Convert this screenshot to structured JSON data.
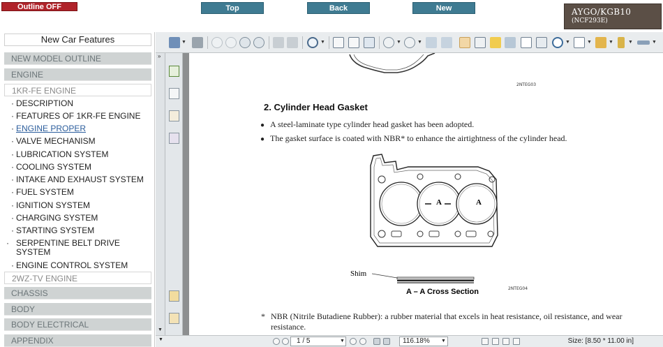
{
  "header": {
    "outline_button": "Outline OFF",
    "nav": [
      {
        "label": "Top"
      },
      {
        "label": "Back"
      },
      {
        "label": "New"
      }
    ],
    "model": {
      "line1": "AYGO/KGB10",
      "line2": "(NCF293E)"
    }
  },
  "sidebar": {
    "title": "New Car Features",
    "categories": [
      {
        "label": "NEW MODEL OUTLINE"
      },
      {
        "label": "ENGINE"
      },
      {
        "label": "1KR-FE ENGINE"
      },
      {
        "label": "2WZ-TV ENGINE"
      },
      {
        "label": "CHASSIS"
      },
      {
        "label": "BODY"
      },
      {
        "label": "BODY ELECTRICAL"
      },
      {
        "label": "APPENDIX"
      }
    ],
    "items": [
      {
        "label": "DESCRIPTION"
      },
      {
        "label": "FEATURES OF 1KR-FE ENGINE"
      },
      {
        "label": "ENGINE PROPER"
      },
      {
        "label": "VALVE MECHANISM"
      },
      {
        "label": "LUBRICATION SYSTEM"
      },
      {
        "label": "COOLING SYSTEM"
      },
      {
        "label": "INTAKE AND EXHAUST SYSTEM"
      },
      {
        "label": "FUEL SYSTEM"
      },
      {
        "label": "IGNITION SYSTEM"
      },
      {
        "label": "CHARGING SYSTEM"
      },
      {
        "label": "STARTING SYSTEM"
      },
      {
        "label": "SERPENTINE BELT DRIVE SYSTEM"
      },
      {
        "label": "ENGINE CONTROL SYSTEM"
      }
    ],
    "active_item": "ENGINE PROPER"
  },
  "document": {
    "figure1_code": "2NTEG03",
    "section_title": "2.  Cylinder Head Gasket",
    "bullets": [
      "A steel-laminate type cylinder head gasket has been adopted.",
      "The gasket surface is coated with NBR* to enhance the airtightness of the cylinder head."
    ],
    "figure2": {
      "section_left": "A",
      "section_right": "A",
      "shim_label": "Shim",
      "cross_section_label": "A – A Cross Section",
      "code": "2NTEG04"
    },
    "footnote_star": "*",
    "footnote": "NBR (Nitrile Butadiene Rubber): a rubber material that excels in heat resistance, oil resistance, and wear resistance."
  },
  "statusbar": {
    "page": "1 / 5",
    "zoom": "116.18%",
    "size": "Size: [8.50 * 11.00 in]"
  },
  "colors": {
    "outline_btn": "#b0232a",
    "nav_btn": "#3f7b92",
    "model_box": "#5b4f46",
    "category_bg": "#cfd3d3",
    "link": "#2b5d9c"
  }
}
